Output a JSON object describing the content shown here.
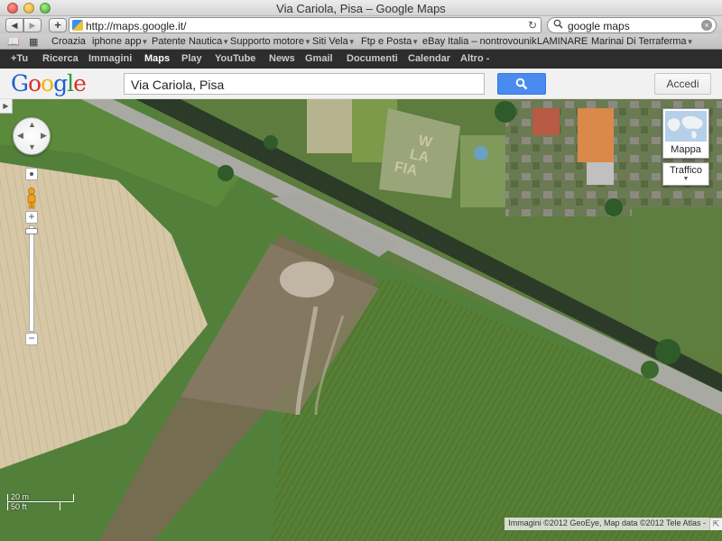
{
  "window": {
    "title": "Via Cariola, Pisa – Google Maps"
  },
  "toolbar": {
    "back": "◀",
    "forward": "▶",
    "add": "+",
    "url": "http://maps.google.it/",
    "reload": "↻",
    "search_value": "google maps",
    "search_icon": "search-icon",
    "clear": "×"
  },
  "bookmarks": {
    "icons": [
      "📖",
      "▦"
    ],
    "items": [
      {
        "label": "Croazia",
        "menu": false
      },
      {
        "label": "iphone app",
        "menu": true
      },
      {
        "label": "Patente Nautica",
        "menu": true
      },
      {
        "label": "Supporto motore",
        "menu": true
      },
      {
        "label": "Siti Vela",
        "menu": true
      },
      {
        "label": "Ftp e Posta",
        "menu": true
      },
      {
        "label": "eBay Italia – nontrovounik",
        "menu": false
      },
      {
        "label": "LAMINARE",
        "menu": false
      },
      {
        "label": "Marinai Di Terraferma",
        "menu": true
      }
    ]
  },
  "gbar": {
    "items": [
      "+Tu",
      "Ricerca",
      "Immagini",
      "Maps",
      "Play",
      "YouTube",
      "News",
      "Gmail",
      "Documenti",
      "Calendar",
      "Altro -"
    ],
    "active": "Maps"
  },
  "header": {
    "logo": [
      "G",
      "o",
      "o",
      "g",
      "l",
      "e"
    ],
    "query": "Via Cariola, Pisa",
    "search_button_icon": "search-icon",
    "signin": "Accedi"
  },
  "map": {
    "field_text": [
      "W",
      "LA",
      "FIA"
    ],
    "pan": {
      "up": "▲",
      "down": "▼",
      "left": "◀",
      "right": "▶"
    },
    "zoom_in": "+",
    "zoom_out": "−",
    "map_type": "Mappa",
    "traffic": "Traffico",
    "scale_metric": "20 m",
    "scale_imperial": "50 ft",
    "attribution": "Immagini ©2012 GeoEye, Map data ©2012 Tele Atlas -",
    "colors": {
      "grass": "#4d7a32",
      "road": "#a9a9a4",
      "bare_soil": "#d8c8a8"
    }
  }
}
